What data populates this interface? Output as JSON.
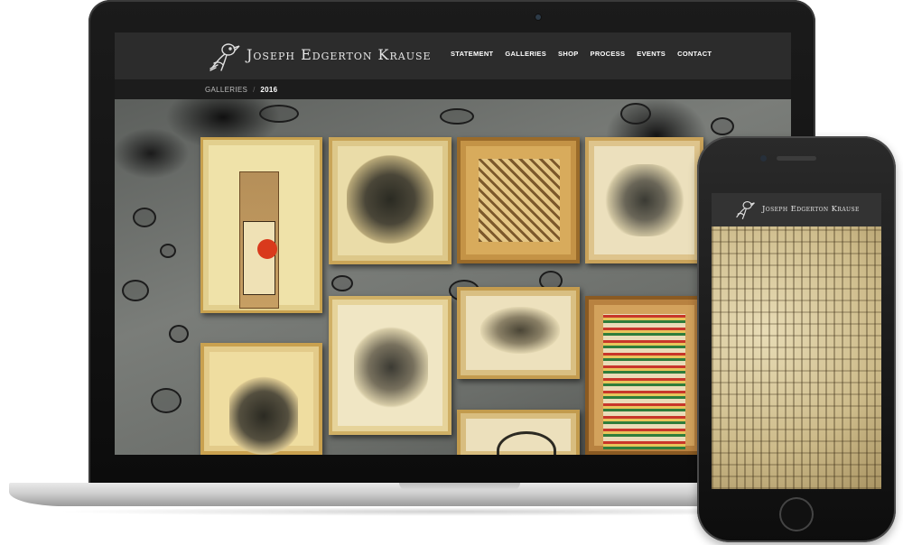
{
  "site": {
    "title": "Joseph Edgerton Krause",
    "nav": [
      "Statement",
      "Galleries",
      "Shop",
      "Process",
      "Events",
      "Contact"
    ]
  },
  "breadcrumb": {
    "parent": "Galleries",
    "current": "2016"
  },
  "icons": {
    "logo": "bird-logo-icon",
    "home_button": "home-button-icon"
  },
  "colors": {
    "header_bg": "#2c2c2c",
    "breadcrumb_bg": "#1c1c1c",
    "nav_text": "#ffffff",
    "wall": "#6b6e6a",
    "frame_gold": "#c99a3b"
  },
  "phone": {
    "title": "Joseph Edgerton Krause"
  }
}
